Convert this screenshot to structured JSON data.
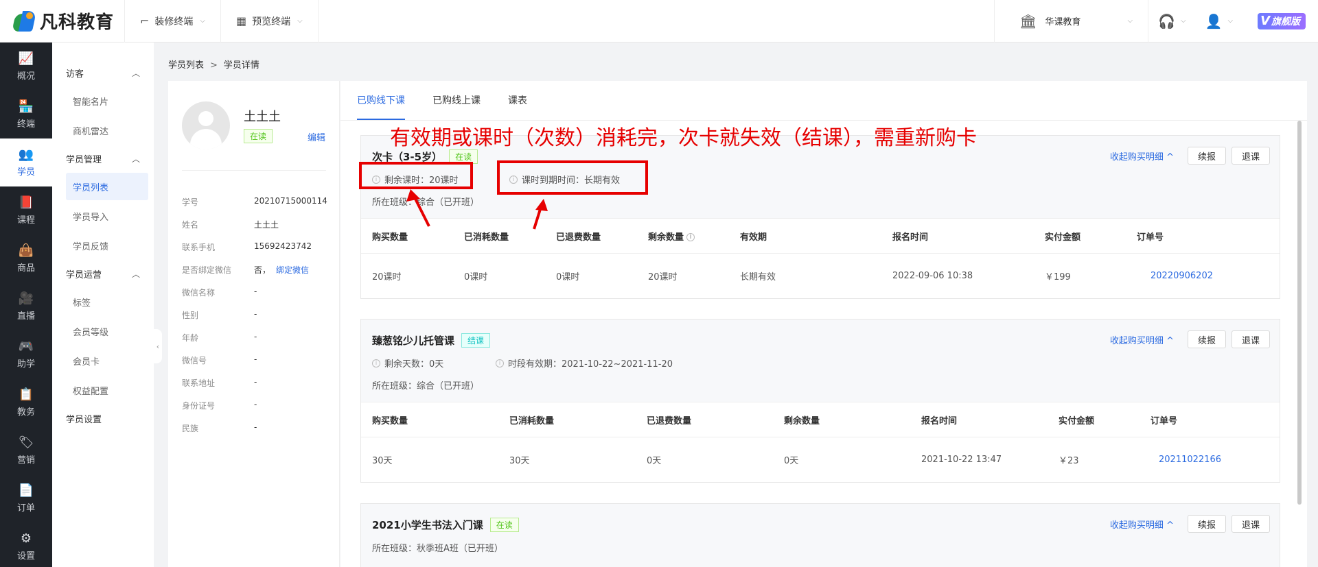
{
  "header": {
    "logo_text": "凡科教育",
    "menus": [
      {
        "label": "装修终端",
        "icon": "paint-roller-icon"
      },
      {
        "label": "预览终端",
        "icon": "grid-icon"
      }
    ],
    "org_name": "华课教育",
    "flagship_label": "旗舰版"
  },
  "leftnav": [
    {
      "label": "概况",
      "icon": "chart-icon"
    },
    {
      "label": "终端",
      "icon": "store-icon"
    },
    {
      "label": "学员",
      "icon": "users-icon",
      "active": true
    },
    {
      "label": "课程",
      "icon": "book-icon"
    },
    {
      "label": "商品",
      "icon": "bag-icon"
    },
    {
      "label": "直播",
      "icon": "video-icon"
    },
    {
      "label": "助学",
      "icon": "gamepad-icon"
    },
    {
      "label": "教务",
      "icon": "clipboard-icon"
    },
    {
      "label": "营销",
      "icon": "tag-icon"
    },
    {
      "label": "订单",
      "icon": "document-icon"
    },
    {
      "label": "设置",
      "icon": "gear-icon"
    }
  ],
  "submenu": {
    "groups": [
      {
        "label": "访客",
        "items": [
          "智能名片",
          "商机雷达"
        ]
      },
      {
        "label": "学员管理",
        "items": [
          "学员列表",
          "学员导入",
          "学员反馈"
        ]
      },
      {
        "label": "学员运营",
        "items": [
          "标签",
          "会员等级",
          "会员卡",
          "权益配置"
        ]
      },
      {
        "label": "学员设置",
        "items": []
      }
    ],
    "active_item": "学员列表"
  },
  "breadcrumb": {
    "parent": "学员列表",
    "sep": ">",
    "current": "学员详情"
  },
  "profile": {
    "name": "土土土",
    "status": "在读",
    "edit_label": "编辑",
    "fields": [
      {
        "key": "学号",
        "value": "20210715000114"
      },
      {
        "key": "姓名",
        "value": "土土土"
      },
      {
        "key": "联系手机",
        "value": "15692423742"
      },
      {
        "key": "是否绑定微信",
        "value": "否，",
        "link": "绑定微信"
      },
      {
        "key": "微信名称",
        "value": "-"
      },
      {
        "key": "性别",
        "value": "-"
      },
      {
        "key": "年龄",
        "value": "-"
      },
      {
        "key": "微信号",
        "value": "-"
      },
      {
        "key": "联系地址",
        "value": "-"
      },
      {
        "key": "身份证号",
        "value": "-"
      },
      {
        "key": "民族",
        "value": "-"
      }
    ]
  },
  "tabs": [
    {
      "label": "已购线下课",
      "active": true
    },
    {
      "label": "已购线上课"
    },
    {
      "label": "课表"
    }
  ],
  "courses": [
    {
      "title": "次卡（3-5岁）",
      "status": "在读",
      "collapse_label": "收起购买明细",
      "renew_label": "续报",
      "refund_label": "退课",
      "meta1": "剩余课时：20课时",
      "meta2": "课时到期时间：长期有效",
      "klass": "所在班级：综合（已开班）",
      "headers": [
        "购买数量",
        "已消耗数量",
        "已退费数量",
        "剩余数量",
        "有效期",
        "报名时间",
        "实付金额",
        "订单号"
      ],
      "row": [
        "20课时",
        "0课时",
        "0课时",
        "20课时",
        "长期有效",
        "2022-09-06 10:38",
        "￥199",
        "20220906202"
      ]
    },
    {
      "title": "臻葱铭少儿托管课",
      "status": "结课",
      "collapse_label": "收起购买明细",
      "renew_label": "续报",
      "refund_label": "退课",
      "meta1": "剩余天数：0天",
      "meta2": "时段有效期：2021-10-22~2021-11-20",
      "klass": "所在班级：综合（已开班）",
      "headers": [
        "购买数量",
        "已消耗数量",
        "已退费数量",
        "剩余数量",
        "报名时间",
        "实付金额",
        "订单号"
      ],
      "row": [
        "30天",
        "30天",
        "0天",
        "0天",
        "2021-10-22 13:47",
        "￥23",
        "20211022166"
      ]
    },
    {
      "title": "2021小学生书法入门课",
      "status": "在读",
      "collapse_label": "收起购买明细",
      "renew_label": "续报",
      "refund_label": "退课",
      "klass": "所在班级：秋季班A班（已开班）"
    }
  ],
  "annotation": "有效期或课时（次数）消耗完，次卡就失效（结课），需重新购卡",
  "colors": {
    "accent": "#2b6ae0",
    "nav_bg": "#1f2329",
    "annotation": "#e60000",
    "reading": "#52c41a",
    "done": "#13c2c2"
  }
}
